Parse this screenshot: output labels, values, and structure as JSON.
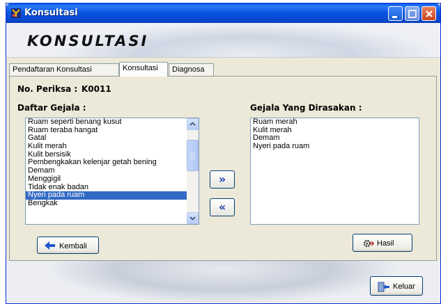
{
  "window": {
    "title": "Konsultasi"
  },
  "header": {
    "heading": "KONSULTASI"
  },
  "tabs": [
    {
      "label": "Pendaftaran Konsultasi"
    },
    {
      "label": "Konsultasi"
    },
    {
      "label": "Diagnosa"
    }
  ],
  "form": {
    "no_periksa_label": "No. Periksa :",
    "no_periksa_value": "K0011",
    "available_label": "Daftar Gejala :",
    "selected_label": "Gejala Yang Dirasakan :"
  },
  "available_symptoms": [
    "Ruam seperti benang kusut",
    "Ruam teraba hangat",
    "Gatal",
    "Kulit merah",
    "Kulit bersisik",
    "Pembengkakan kelenjar getah bening",
    "Demam",
    "Menggigil",
    "Tidak enak badan",
    "Nyeri pada ruam",
    "Bengkak"
  ],
  "selected_index": 9,
  "selected_symptoms": [
    "Ruam merah",
    "Kulit merah",
    "Demam",
    "Nyeri pada ruam"
  ],
  "buttons": {
    "add": "»",
    "remove": "«",
    "back": "Kembali",
    "result": "Hasil",
    "exit": "Keluar"
  },
  "colors": {
    "titlebar": "#0a5ae8",
    "selection": "#316ac5",
    "arrow_blue": "#1a3fae"
  }
}
